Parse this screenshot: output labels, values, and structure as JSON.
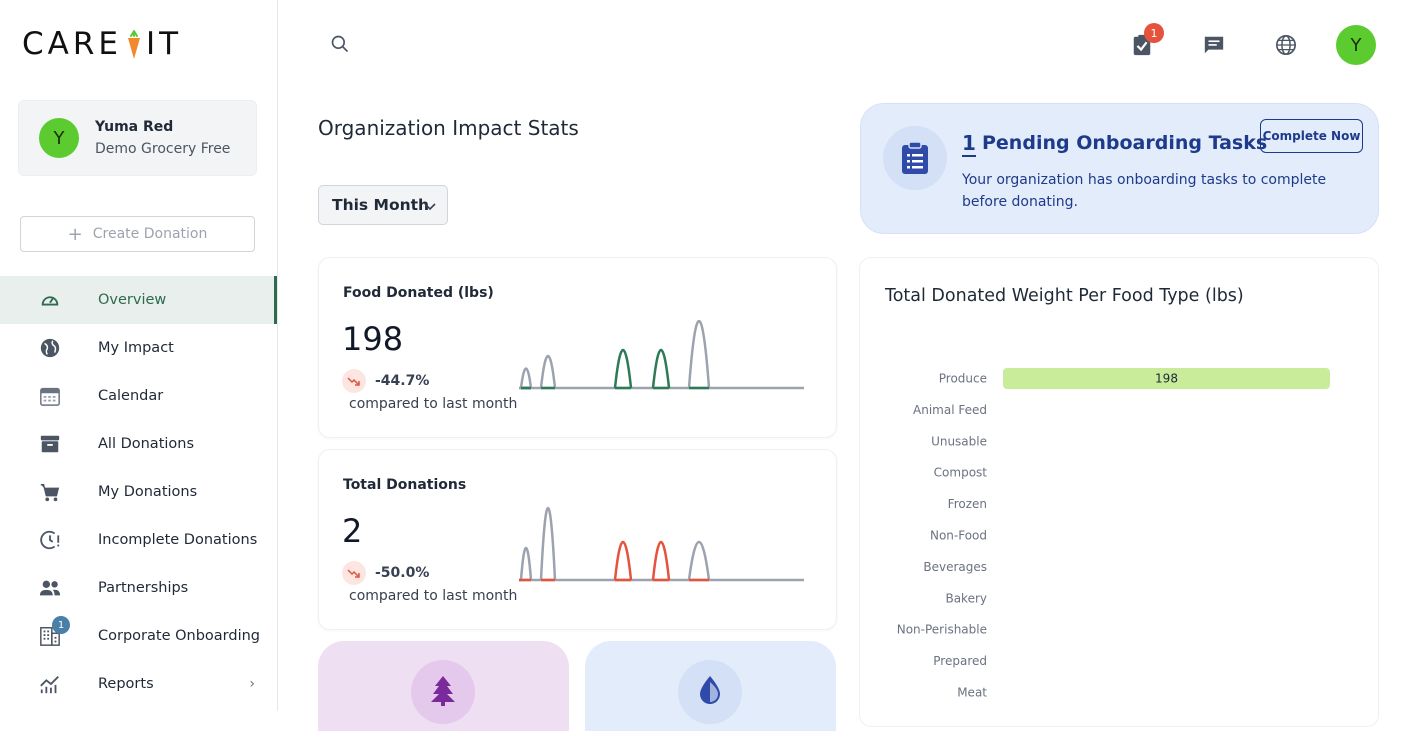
{
  "brand": {
    "logo_text_left": "CARE",
    "logo_text_right": "IT"
  },
  "user": {
    "initial": "Y",
    "name": "Yuma Red",
    "org": "Demo Grocery Free"
  },
  "sidebar": {
    "create_label": "Create Donation",
    "items": [
      {
        "label": "Overview",
        "icon": "gauge-icon",
        "active": true
      },
      {
        "label": "My Impact",
        "icon": "globe-icon"
      },
      {
        "label": "Calendar",
        "icon": "calendar-icon"
      },
      {
        "label": "All Donations",
        "icon": "archive-icon"
      },
      {
        "label": "My Donations",
        "icon": "cart-icon"
      },
      {
        "label": "Incomplete Donations",
        "icon": "clock-alert-icon"
      },
      {
        "label": "Partnerships",
        "icon": "people-icon"
      },
      {
        "label": "Corporate Onboarding",
        "icon": "building-icon",
        "badge": "1"
      },
      {
        "label": "Reports",
        "icon": "chart-icon",
        "chevron": "›"
      }
    ]
  },
  "header": {
    "tasks_badge": "1",
    "avatar_initial": "Y"
  },
  "main": {
    "title": "Organization Impact Stats",
    "period": "This Month",
    "food_donated": {
      "label": "Food Donated (lbs)",
      "value": "198",
      "change": "-44.7%",
      "note": "compared to last month",
      "accent": "#2d7a57"
    },
    "total_donations": {
      "label": "Total Donations",
      "value": "2",
      "change": "-50.0%",
      "note": "compared to last month",
      "accent": "#e5533d"
    }
  },
  "onboarding": {
    "count": "1",
    "title": "Pending Onboarding Tasks",
    "description": "Your organization has onboarding tasks to complete before donating.",
    "button": "Complete Now"
  },
  "chart_data": {
    "type": "bar",
    "title": "Total Donated Weight Per Food Type (lbs)",
    "orientation": "horizontal",
    "categories": [
      "Produce",
      "Animal Feed",
      "Unusable",
      "Compost",
      "Frozen",
      "Non-Food",
      "Beverages",
      "Bakery",
      "Non-Perishable",
      "Prepared",
      "Meat"
    ],
    "values": [
      198,
      0,
      0,
      0,
      0,
      0,
      0,
      0,
      0,
      0,
      0
    ],
    "data_labels": [
      "198",
      "",
      "",
      "",
      "",
      "",
      "",
      "",
      "",
      "",
      ""
    ],
    "xlim": [
      0,
      198
    ],
    "bar_color": "#c8ec9a"
  },
  "colors": {
    "brand_green": "#5ccb2f",
    "active_nav": "#2d6a4f",
    "banner_blue": "#1e3a8a",
    "alert_red": "#e5533d"
  }
}
